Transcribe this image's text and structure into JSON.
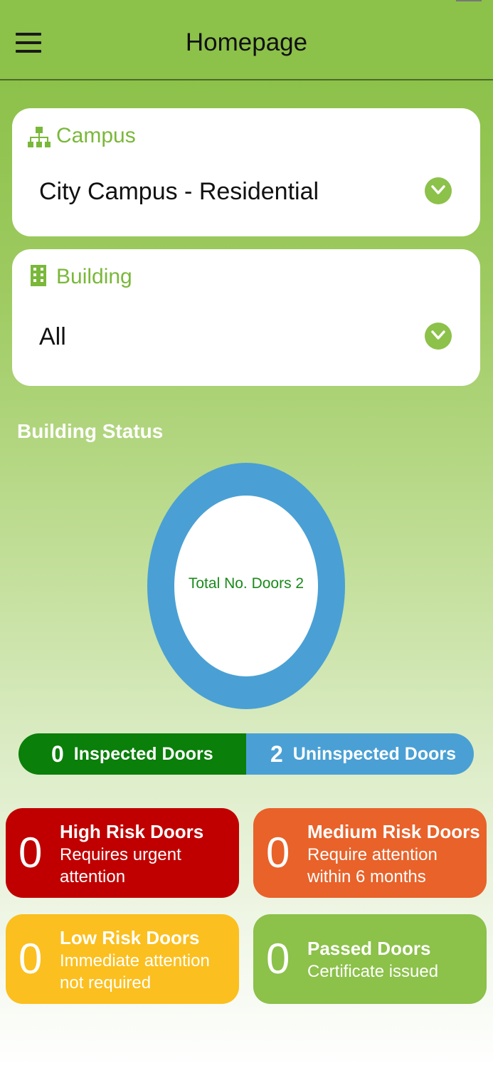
{
  "header": {
    "title": "Homepage",
    "menu_icon": "hamburger-icon"
  },
  "campus": {
    "label": "Campus",
    "value": "City Campus - Residential",
    "icon": "sitemap-icon"
  },
  "building": {
    "label": "Building",
    "value": "All",
    "icon": "building-icon"
  },
  "status": {
    "title": "Building Status",
    "donut_text": "Total No. Doors 2",
    "inspected": {
      "count": "0",
      "label": "Inspected Doors"
    },
    "uninspected": {
      "count": "2",
      "label": "Uninspected Doors"
    }
  },
  "tiles": {
    "high": {
      "count": "0",
      "title": "High Risk Doors",
      "desc": "Requires urgent attention",
      "color": "#c00000"
    },
    "medium": {
      "count": "0",
      "title": "Medium Risk Doors",
      "desc": "Require attention within 6 months",
      "color": "#e8622a"
    },
    "low": {
      "count": "0",
      "title": "Low Risk Doors",
      "desc": "Immediate attention not required",
      "color": "#fbbf1f"
    },
    "passed": {
      "count": "0",
      "title": "Passed Doors",
      "desc": "Certificate issued",
      "color": "#8cc14a"
    }
  },
  "colors": {
    "brand": "#8cc14a",
    "inspected": "#0a7f0a",
    "uninspected": "#4aa0d4"
  }
}
